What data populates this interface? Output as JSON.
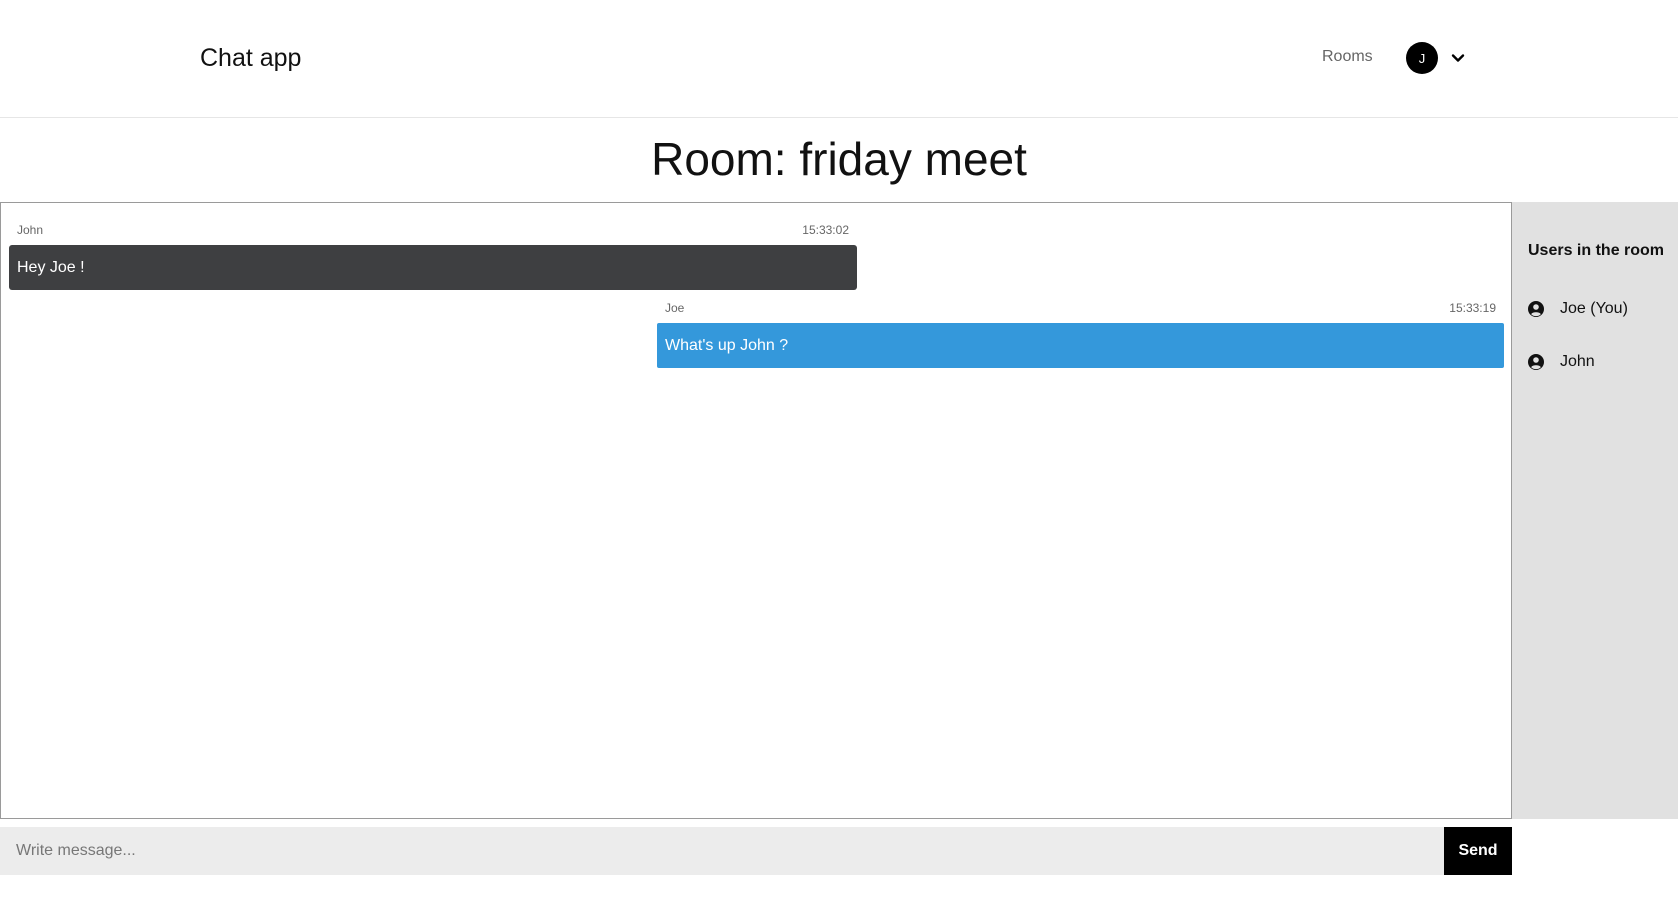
{
  "app": {
    "title": "Chat app"
  },
  "nav": {
    "rooms_label": "Rooms",
    "avatar_initial": "J",
    "avatar_bg": "#000000"
  },
  "room": {
    "title": "Room: friday meet"
  },
  "messages": [
    {
      "author": "John",
      "time": "15:33:02",
      "text": "Hey Joe !",
      "side": "left",
      "bubble_color": "#3e3f41"
    },
    {
      "author": "Joe",
      "time": "15:33:19",
      "text": "What's up John ?",
      "side": "right",
      "bubble_color": "#3498db"
    }
  ],
  "sidebar": {
    "title": "Users in the room",
    "users": [
      {
        "name": "Joe (You)",
        "icon": "user-circle-icon"
      },
      {
        "name": "John",
        "icon": "user-circle-icon"
      }
    ]
  },
  "composer": {
    "placeholder": "Write message...",
    "value": "",
    "send_label": "Send"
  }
}
